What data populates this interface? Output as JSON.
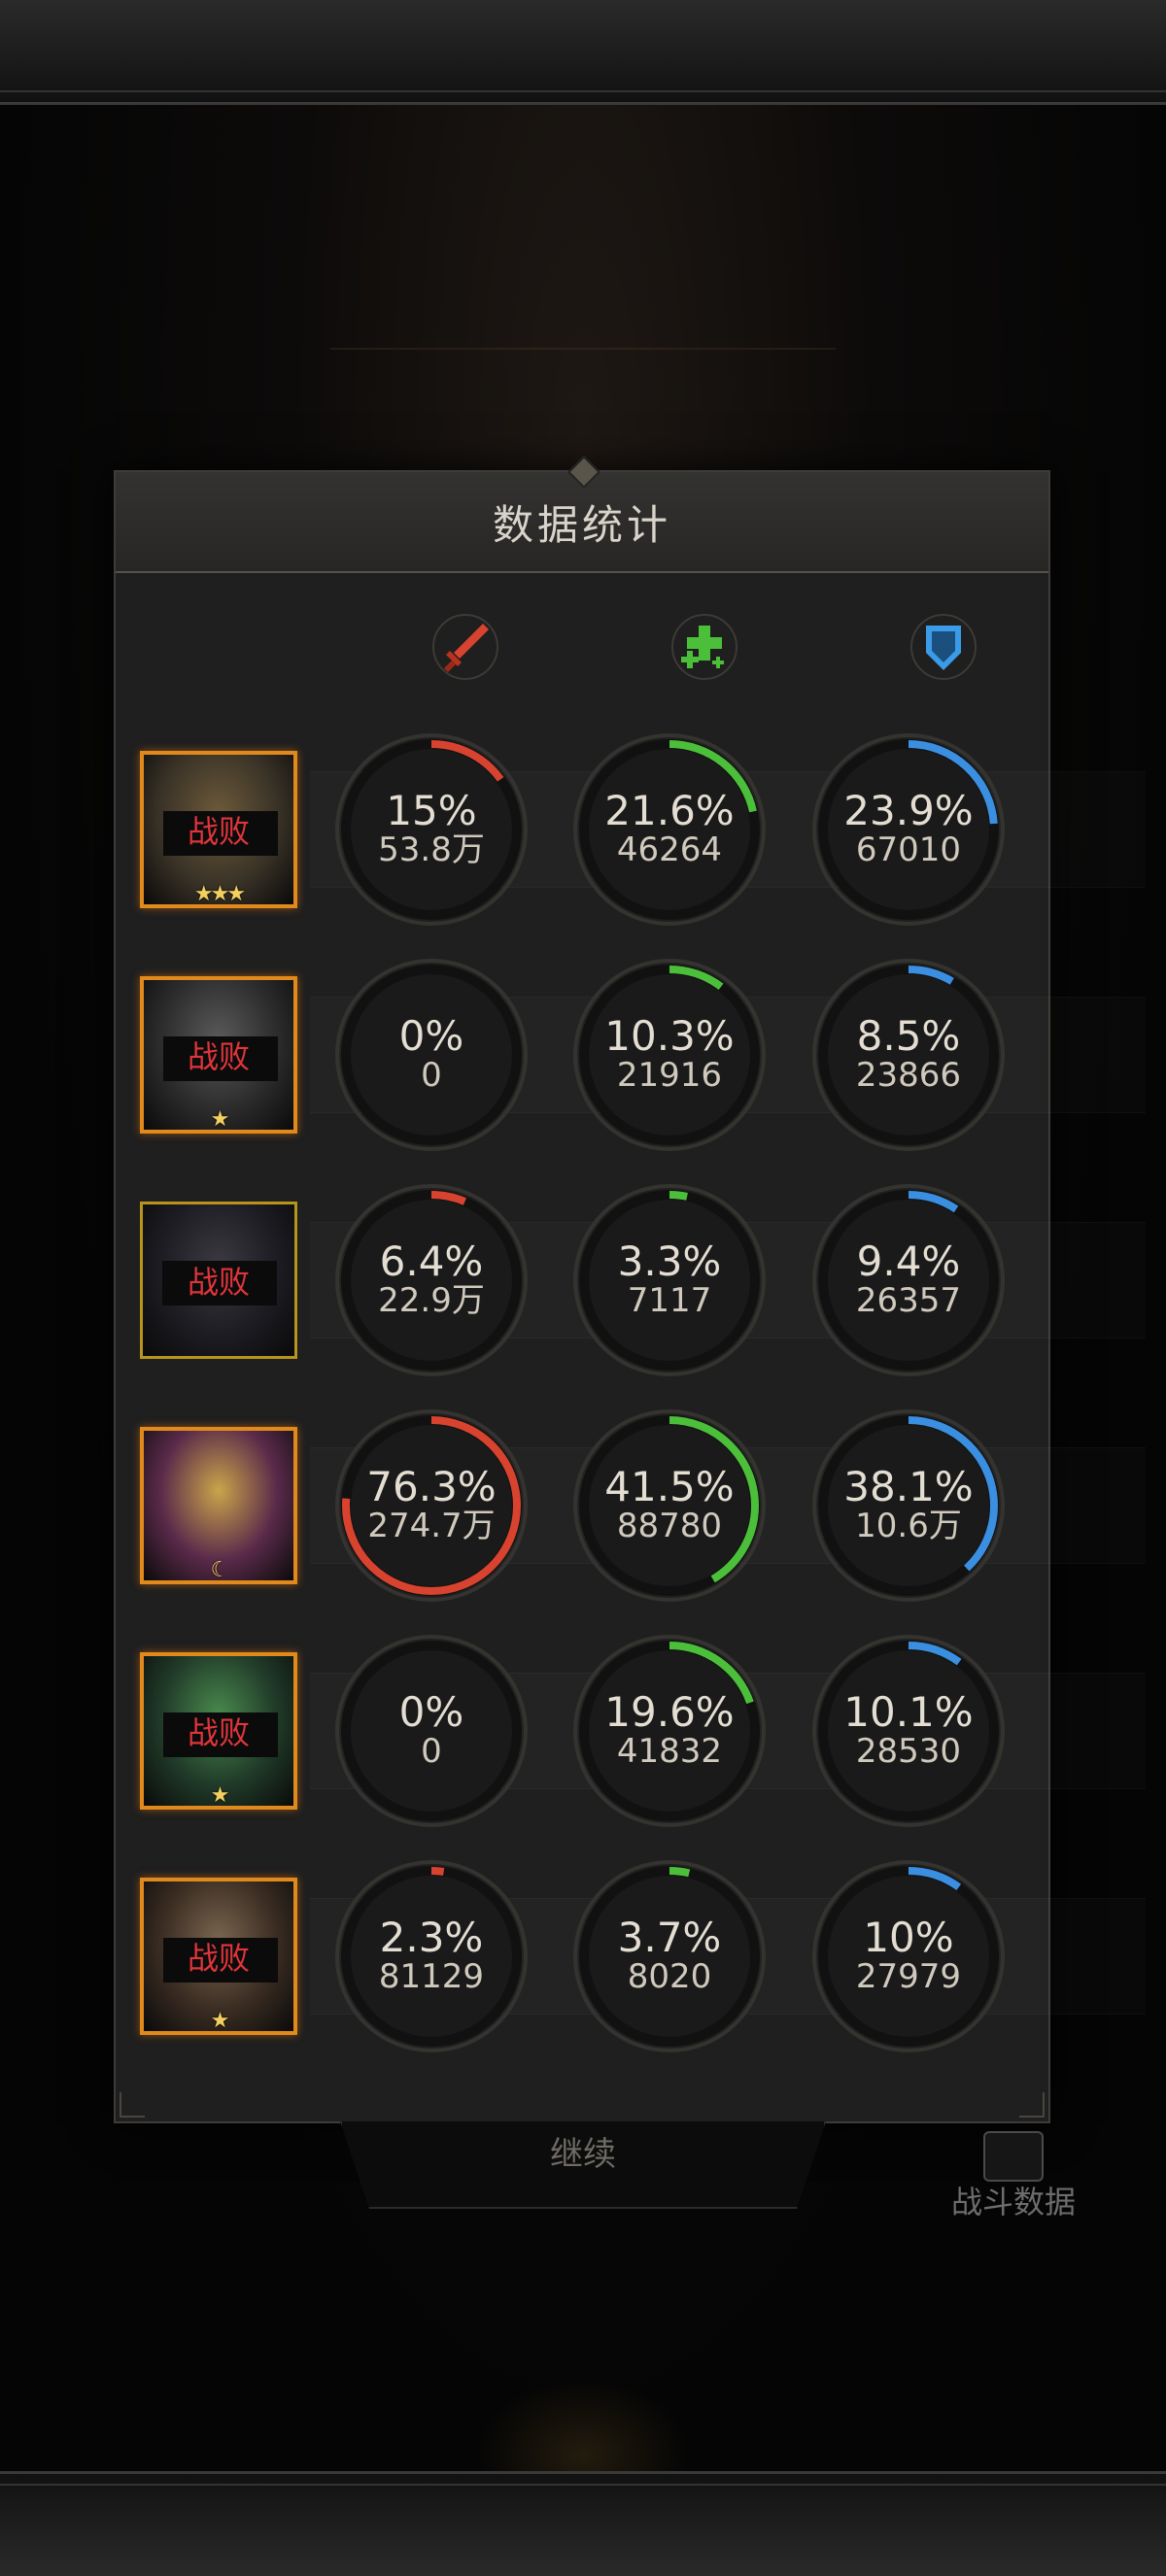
{
  "panel": {
    "title": "数据统计"
  },
  "columns": [
    {
      "icon": "sword-icon",
      "color": "#d8432f"
    },
    {
      "icon": "heal-cross-icon",
      "color": "#4cbf3a"
    },
    {
      "icon": "shield-icon",
      "color": "#3a8fe0"
    }
  ],
  "rows": [
    {
      "status": "战败",
      "stars": "★★★",
      "frame": "fire",
      "damage": {
        "pct": "15%",
        "value": "53.8万",
        "ratio": 0.15
      },
      "heal": {
        "pct": "21.6%",
        "value": "46264",
        "ratio": 0.216
      },
      "tank": {
        "pct": "23.9%",
        "value": "67010",
        "ratio": 0.239
      }
    },
    {
      "status": "战败",
      "stars": "★",
      "frame": "fire",
      "damage": {
        "pct": "0%",
        "value": "0",
        "ratio": 0
      },
      "heal": {
        "pct": "10.3%",
        "value": "21916",
        "ratio": 0.103
      },
      "tank": {
        "pct": "8.5%",
        "value": "23866",
        "ratio": 0.085
      }
    },
    {
      "status": "战败",
      "stars": "",
      "frame": "gold",
      "damage": {
        "pct": "6.4%",
        "value": "22.9万",
        "ratio": 0.064
      },
      "heal": {
        "pct": "3.3%",
        "value": "7117",
        "ratio": 0.033
      },
      "tank": {
        "pct": "9.4%",
        "value": "26357",
        "ratio": 0.094
      }
    },
    {
      "status": "",
      "stars": "☾",
      "frame": "fire",
      "damage": {
        "pct": "76.3%",
        "value": "274.7万",
        "ratio": 0.763
      },
      "heal": {
        "pct": "41.5%",
        "value": "88780",
        "ratio": 0.415
      },
      "tank": {
        "pct": "38.1%",
        "value": "10.6万",
        "ratio": 0.381
      }
    },
    {
      "status": "战败",
      "stars": "★",
      "frame": "fire",
      "damage": {
        "pct": "0%",
        "value": "0",
        "ratio": 0
      },
      "heal": {
        "pct": "19.6%",
        "value": "41832",
        "ratio": 0.196
      },
      "tank": {
        "pct": "10.1%",
        "value": "28530",
        "ratio": 0.101
      }
    },
    {
      "status": "战败",
      "stars": "★",
      "frame": "fire",
      "damage": {
        "pct": "2.3%",
        "value": "81129",
        "ratio": 0.023
      },
      "heal": {
        "pct": "3.7%",
        "value": "8020",
        "ratio": 0.037
      },
      "tank": {
        "pct": "10%",
        "value": "27979",
        "ratio": 0.1
      }
    }
  ],
  "footer": {
    "continue_label": "继续",
    "stats_label": "战斗数据"
  }
}
